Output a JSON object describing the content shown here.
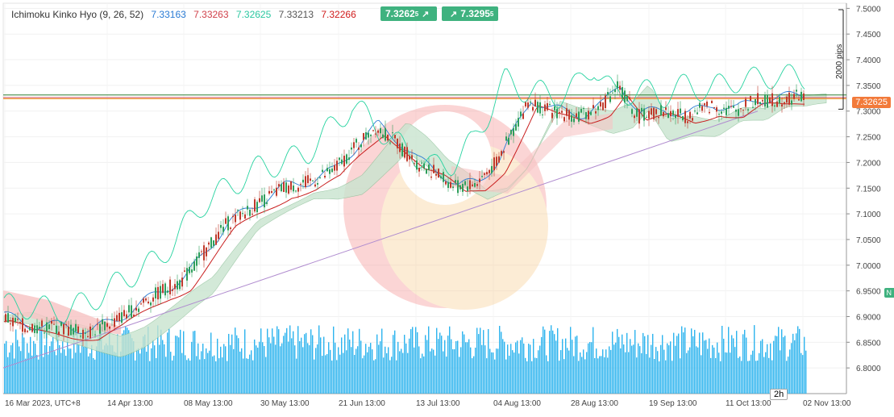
{
  "indicator": {
    "name": "Ichimoku Kinko Hyo (9, 26, 52)",
    "values": [
      {
        "text": "7.33163",
        "color": "#2a7bd4"
      },
      {
        "text": "7.33263",
        "color": "#d0404a"
      },
      {
        "text": "7.32625",
        "color": "#2bc7a0"
      },
      {
        "text": "7.33213",
        "color": "#555555"
      },
      {
        "text": "7.32266",
        "color": "#d01c1c"
      }
    ]
  },
  "trade_buttons": {
    "sell_price": "7.3262",
    "sell_super": "5",
    "buy_price": "7.3295",
    "buy_super": "5"
  },
  "price_tag": "7.32625",
  "measure_label": "2000 pips",
  "timeframe": "2h",
  "edge_badge": "N",
  "colors": {
    "candle_up": "#2e9e5b",
    "candle_down": "#c0392b",
    "tenkan": "#2a7bd4",
    "kijun": "#c81d1d",
    "chikou": "#27d3a0",
    "cloud_bull": "#c9e4cf",
    "cloud_bear": "#f7c5c5",
    "volume": "#2db4ee",
    "trendline": "#b08ccf"
  },
  "chart_data": {
    "type": "line",
    "title": "",
    "xlabel": "",
    "ylabel": "",
    "x_tick_labels": [
      "16 Mar 2023, UTC+8",
      "14 Apr 13:00",
      "08 May 13:00",
      "30 May 13:00",
      "21 Jun 13:00",
      "13 Jul 13:00",
      "04 Aug 13:00",
      "28 Aug 13:00",
      "19 Sep 13:00",
      "11 Oct 13:00",
      "02 Nov 13:00"
    ],
    "y_ticks": [
      "7.5000",
      "7.4500",
      "7.4000",
      "7.3500",
      "7.3000",
      "7.2500",
      "7.2000",
      "7.1500",
      "7.1000",
      "7.0500",
      "7.0000",
      "6.9500",
      "6.9000",
      "6.8500",
      "6.8000"
    ],
    "ylim": [
      6.75,
      7.51
    ],
    "grid": true,
    "price_anchors": [
      [
        0,
        6.9
      ],
      [
        30,
        6.88
      ],
      [
        60,
        6.88
      ],
      [
        110,
        6.87
      ],
      [
        140,
        6.89
      ],
      [
        170,
        6.92
      ],
      [
        200,
        6.95
      ],
      [
        225,
        6.97
      ],
      [
        250,
        7.02
      ],
      [
        280,
        7.08
      ],
      [
        320,
        7.12
      ],
      [
        350,
        7.15
      ],
      [
        380,
        7.16
      ],
      [
        410,
        7.18
      ],
      [
        440,
        7.23
      ],
      [
        465,
        7.27
      ],
      [
        490,
        7.24
      ],
      [
        515,
        7.2
      ],
      [
        540,
        7.18
      ],
      [
        565,
        7.15
      ],
      [
        590,
        7.16
      ],
      [
        615,
        7.2
      ],
      [
        635,
        7.26
      ],
      [
        655,
        7.32
      ],
      [
        680,
        7.3
      ],
      [
        720,
        7.29
      ],
      [
        745,
        7.31
      ],
      [
        765,
        7.35
      ],
      [
        790,
        7.29
      ],
      [
        820,
        7.3
      ],
      [
        850,
        7.29
      ],
      [
        880,
        7.31
      ],
      [
        910,
        7.3
      ],
      [
        935,
        7.32
      ],
      [
        960,
        7.32
      ],
      [
        990,
        7.33
      ],
      [
        1000,
        7.326
      ]
    ],
    "series": [
      {
        "key": "price",
        "values_ref": "price_anchors"
      },
      {
        "key": "tenkan",
        "values_ref": "price_anchors"
      },
      {
        "key": "kijun",
        "values_ref": "price_anchors"
      },
      {
        "key": "chikou",
        "values_ref": "price_anchors"
      }
    ],
    "trendline": {
      "from": [
        0,
        6.8
      ],
      "to": [
        940,
        7.3
      ]
    },
    "horizontal_lines": [
      {
        "value": 7.3263,
        "color": "#d0404a"
      },
      {
        "value": 7.3313,
        "color": "#2e7d32"
      },
      {
        "value": 7.324,
        "color": "#f0a030"
      }
    ],
    "measure": {
      "from": 7.51,
      "to": 7.31
    }
  }
}
